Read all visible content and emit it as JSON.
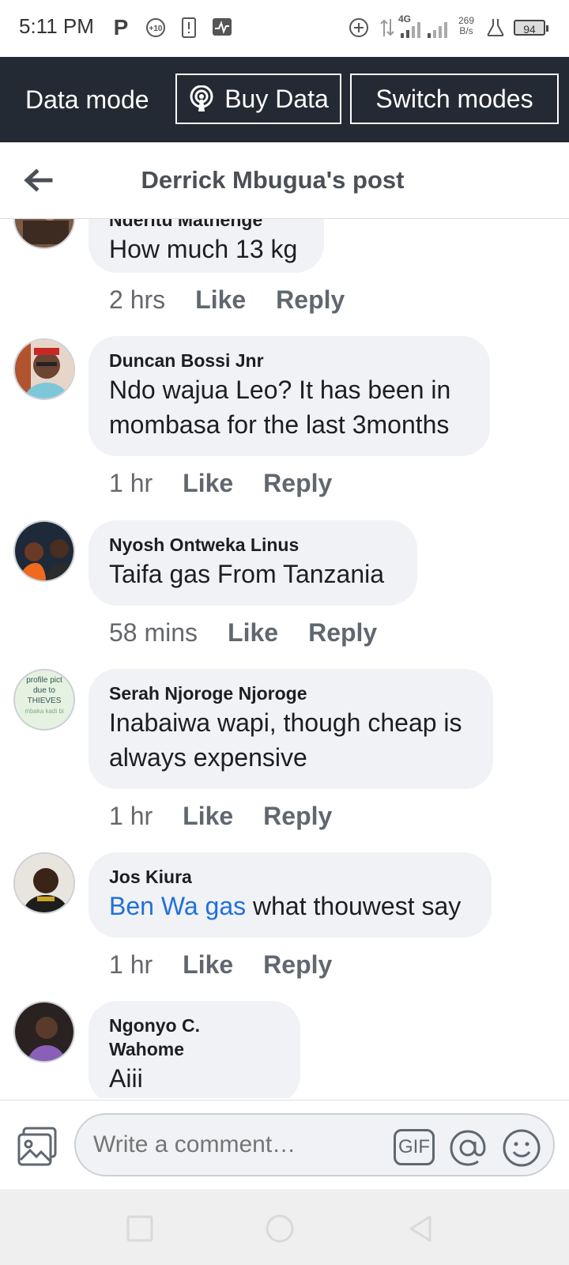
{
  "status_bar": {
    "time": "5:11 PM",
    "network_type": "4G",
    "speed_value": "269",
    "speed_unit": "B/s",
    "battery": "94",
    "icons": [
      "parking-icon",
      "plus10-icon",
      "sim-alert-icon",
      "activity-icon",
      "add-circle-icon",
      "data-arrows-icon",
      "signal-icon",
      "signal-icon",
      "lab-icon"
    ]
  },
  "data_banner": {
    "label": "Data mode",
    "buy_data": "Buy Data",
    "switch_modes": "Switch modes"
  },
  "header": {
    "title": "Derrick Mbugua's post"
  },
  "comments": [
    {
      "name": "Nderitu Mathenge",
      "text": "How much 13 kg",
      "time": "2 hrs",
      "like": "Like",
      "reply": "Reply"
    },
    {
      "name": "Duncan Bossi Jnr",
      "text": "Ndo wajua Leo? It has been in mombasa for the last 3months",
      "time": "1 hr",
      "like": "Like",
      "reply": "Reply"
    },
    {
      "name": "Nyosh Ontweka Linus",
      "text": "Taifa gas From Tanzania",
      "time": "58 mins",
      "like": "Like",
      "reply": "Reply"
    },
    {
      "name": "Serah Njoroge Njoroge",
      "text": "Inabaiwa wapi, though cheap is always expensive",
      "avatar_text": [
        "profile pict",
        "due to",
        "THIEVES",
        "mbaka kadi bi"
      ],
      "time": "1 hr",
      "like": "Like",
      "reply": "Reply"
    },
    {
      "name": "Jos Kiura",
      "mention": "Ben Wa gas",
      "text": " what thouwest say",
      "time": "1 hr",
      "like": "Like",
      "reply": "Reply"
    },
    {
      "name": "Ngonyo C. Wahome",
      "text": "Aiii"
    }
  ],
  "composer": {
    "placeholder": "Write a comment…",
    "gif_label": "GIF"
  },
  "colors": {
    "banner_bg": "#232a33",
    "bubble_bg": "#f0f2f5",
    "link": "#216fdb",
    "meta": "#65676b"
  }
}
